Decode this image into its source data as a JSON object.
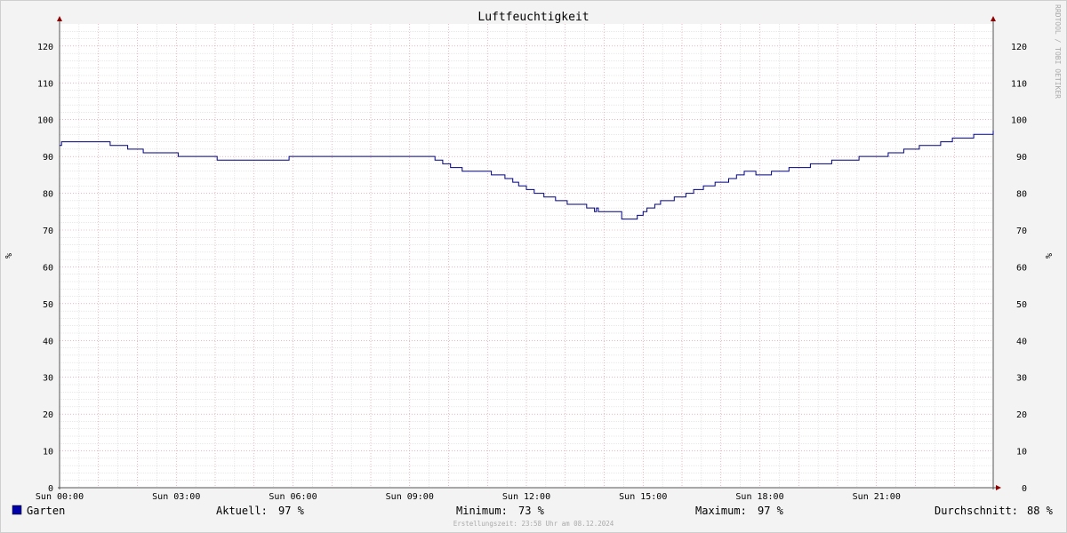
{
  "watermark": "RRDTOOL / TOBI OETIKER",
  "footer": {
    "created": "Erstellungszeit: 23:58 Uhr am 08.12.2024"
  },
  "legend": {
    "series_name": "Garten",
    "current_label": "Aktuell:",
    "current_value": "97 %",
    "min_label": "Minimum:",
    "min_value": "73 %",
    "max_label": "Maximum:",
    "max_value": "97 %",
    "avg_label": "Durchschnitt:",
    "avg_value": "88 %"
  },
  "colors": {
    "background": "#f3f3f3",
    "canvas": "#ffffff",
    "line": "#00007f",
    "legend_swatch": "#0000a8",
    "major_grid": "#e58a9c",
    "minor_grid": "#d2d2d2",
    "axis": "#8a0000",
    "text": "#000000",
    "faint_text": "#aaaaaa"
  },
  "chart_data": {
    "type": "line",
    "title": "Luftfeuchtigkeit",
    "ylabel": "%",
    "ylabel_right": "%",
    "xlim": [
      0,
      24
    ],
    "ylim": [
      0,
      126
    ],
    "y_ticks": [
      0,
      10,
      20,
      30,
      40,
      50,
      60,
      70,
      80,
      90,
      100,
      110,
      120
    ],
    "x_ticks": [
      {
        "x": 0,
        "label": "Sun 00:00"
      },
      {
        "x": 3,
        "label": "Sun 03:00"
      },
      {
        "x": 6,
        "label": "Sun 06:00"
      },
      {
        "x": 9,
        "label": "Sun 09:00"
      },
      {
        "x": 12,
        "label": "Sun 12:00"
      },
      {
        "x": 15,
        "label": "Sun 15:00"
      },
      {
        "x": 18,
        "label": "Sun 18:00"
      },
      {
        "x": 21,
        "label": "Sun 21:00"
      }
    ],
    "grid": true,
    "legend_position": "bottom",
    "series": [
      {
        "name": "Garten",
        "step": true,
        "x": [
          0,
          0.05,
          1.3,
          1.75,
          2.15,
          3.05,
          4.05,
          5.9,
          9.65,
          9.85,
          10.05,
          10.35,
          11.1,
          11.45,
          11.65,
          11.8,
          12.0,
          12.2,
          12.45,
          12.75,
          13.05,
          13.55,
          13.75,
          13.8,
          13.85,
          14.45,
          14.85,
          15.0,
          15.1,
          15.3,
          15.45,
          15.8,
          16.1,
          16.3,
          16.55,
          16.85,
          17.2,
          17.4,
          17.6,
          17.9,
          18.3,
          18.75,
          19.3,
          19.85,
          20.55,
          21.3,
          21.7,
          22.1,
          22.65,
          22.95,
          23.5,
          24.0
        ],
        "values": [
          93,
          94,
          93,
          92,
          91,
          90,
          89,
          90,
          89,
          88,
          87,
          86,
          85,
          84,
          83,
          82,
          81,
          80,
          79,
          78,
          77,
          76,
          75,
          76,
          75,
          73,
          74,
          75,
          76,
          77,
          78,
          79,
          80,
          81,
          82,
          83,
          84,
          85,
          86,
          85,
          86,
          87,
          88,
          89,
          90,
          91,
          92,
          93,
          94,
          95,
          96,
          97
        ]
      }
    ]
  }
}
